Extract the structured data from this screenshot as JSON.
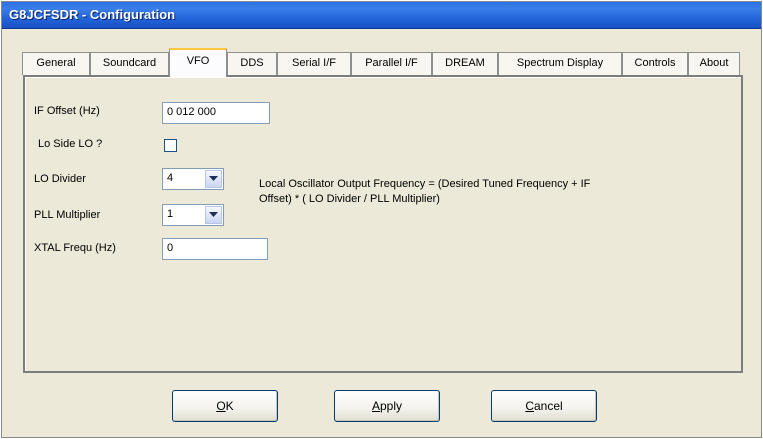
{
  "window": {
    "title": "G8JCFSDR - Configuration"
  },
  "tabs": [
    {
      "label": "General"
    },
    {
      "label": "Soundcard"
    },
    {
      "label": "VFO",
      "active": true
    },
    {
      "label": "DDS"
    },
    {
      "label": "Serial I/F"
    },
    {
      "label": "Parallel I/F"
    },
    {
      "label": "DREAM"
    },
    {
      "label": "Spectrum Display"
    },
    {
      "label": "Controls"
    },
    {
      "label": "About"
    }
  ],
  "vfo": {
    "if_offset_label": "IF Offset (Hz)",
    "if_offset_value": "0 012 000",
    "lo_side_label": "Lo Side LO ?",
    "lo_side_checked": false,
    "lo_divider_label": "LO Divider",
    "lo_divider_value": "4",
    "pll_multiplier_label": "PLL Multiplier",
    "pll_multiplier_value": "1",
    "xtal_label": "XTAL Frequ (Hz)",
    "xtal_value": "0",
    "formula": "Local Oscillator Output Frequency = (Desired Tuned Frequency + IF Offset) * ( LO Divider / PLL Multiplier)"
  },
  "buttons": {
    "ok": {
      "mnemonic": "O",
      "rest": "K"
    },
    "apply": {
      "mnemonic": "A",
      "rest": "pply"
    },
    "cancel": {
      "mnemonic": "C",
      "rest": "ancel"
    }
  },
  "colors": {
    "titlebar": "#2060d6",
    "dialog_bg": "#ece9d8",
    "active_tab_highlight": "#ffc83c"
  }
}
